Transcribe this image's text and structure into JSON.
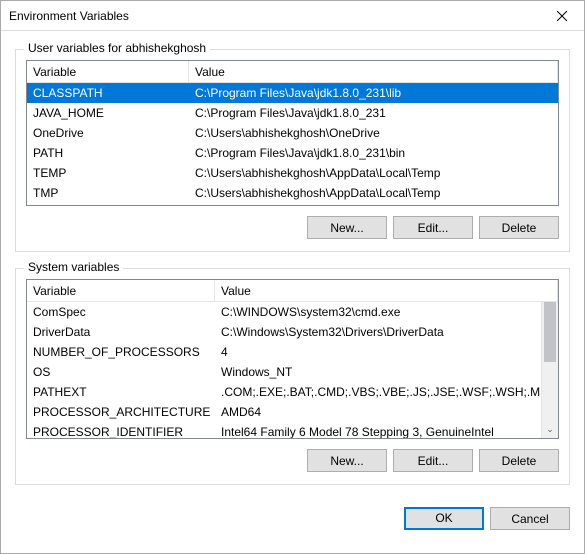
{
  "window": {
    "title": "Environment Variables"
  },
  "user_section": {
    "legend": "User variables for abhishekghosh",
    "columns": {
      "variable": "Variable",
      "value": "Value"
    },
    "rows": [
      {
        "variable": "CLASSPATH",
        "value": "C:\\Program Files\\Java\\jdk1.8.0_231\\lib",
        "selected": true
      },
      {
        "variable": "JAVA_HOME",
        "value": "C:\\Program Files\\Java\\jdk1.8.0_231"
      },
      {
        "variable": "OneDrive",
        "value": "C:\\Users\\abhishekghosh\\OneDrive"
      },
      {
        "variable": "PATH",
        "value": "C:\\Program Files\\Java\\jdk1.8.0_231\\bin"
      },
      {
        "variable": "TEMP",
        "value": "C:\\Users\\abhishekghosh\\AppData\\Local\\Temp"
      },
      {
        "variable": "TMP",
        "value": "C:\\Users\\abhishekghosh\\AppData\\Local\\Temp"
      }
    ],
    "buttons": {
      "new": "New...",
      "edit": "Edit...",
      "delete": "Delete"
    }
  },
  "system_section": {
    "legend": "System variables",
    "columns": {
      "variable": "Variable",
      "value": "Value"
    },
    "rows": [
      {
        "variable": "ComSpec",
        "value": "C:\\WINDOWS\\system32\\cmd.exe"
      },
      {
        "variable": "DriverData",
        "value": "C:\\Windows\\System32\\Drivers\\DriverData"
      },
      {
        "variable": "NUMBER_OF_PROCESSORS",
        "value": "4"
      },
      {
        "variable": "OS",
        "value": "Windows_NT"
      },
      {
        "variable": "PATHEXT",
        "value": ".COM;.EXE;.BAT;.CMD;.VBS;.VBE;.JS;.JSE;.WSF;.WSH;.MSC"
      },
      {
        "variable": "PROCESSOR_ARCHITECTURE",
        "value": "AMD64"
      },
      {
        "variable": "PROCESSOR_IDENTIFIER",
        "value": "Intel64 Family 6 Model 78 Stepping 3, GenuineIntel"
      }
    ],
    "buttons": {
      "new": "New...",
      "edit": "Edit...",
      "delete": "Delete"
    }
  },
  "dialog_buttons": {
    "ok": "OK",
    "cancel": "Cancel"
  }
}
